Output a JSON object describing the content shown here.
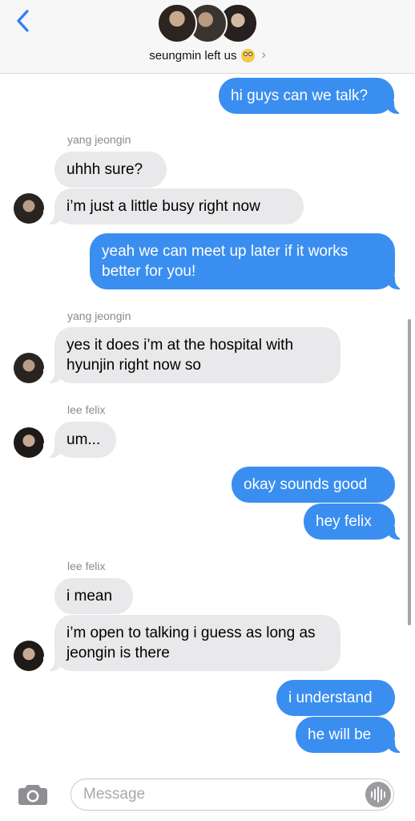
{
  "header": {
    "back_icon": "chevron-left-icon",
    "group_name": "seungmin left us",
    "emoji": "flushed-face-emoji",
    "chevron": "›",
    "accent": "#2f7cf6"
  },
  "messages": [
    {
      "direction": "sent",
      "text": "hi guys can we talk?"
    },
    {
      "sender": "yang jeongin",
      "direction": "received",
      "text": "uhhh sure?"
    },
    {
      "direction": "received",
      "text": "i’m just a little busy right now"
    },
    {
      "direction": "sent",
      "text": "yeah we can meet up later if it works better for you!"
    },
    {
      "sender": "yang jeongin",
      "direction": "received",
      "text": "yes it does i’m at the hospital with hyunjin right now so"
    },
    {
      "sender": "lee felix",
      "direction": "received",
      "text": "um..."
    },
    {
      "direction": "sent",
      "text": "okay sounds good"
    },
    {
      "direction": "sent",
      "text": "hey felix"
    },
    {
      "sender": "lee felix",
      "direction": "received",
      "text": "i mean"
    },
    {
      "direction": "received",
      "text": "i’m open to talking i guess as long as jeongin is there"
    },
    {
      "direction": "sent",
      "text": "i understand"
    },
    {
      "direction": "sent",
      "text": "he will be"
    }
  ],
  "input": {
    "placeholder": "Message",
    "camera_icon": "camera-icon",
    "audio_icon": "audio-waveform-icon"
  },
  "colors": {
    "sent_bubble": "#3a8ef0",
    "received_bubble": "#e9e9eb",
    "sender_label": "#8a8a8e"
  }
}
